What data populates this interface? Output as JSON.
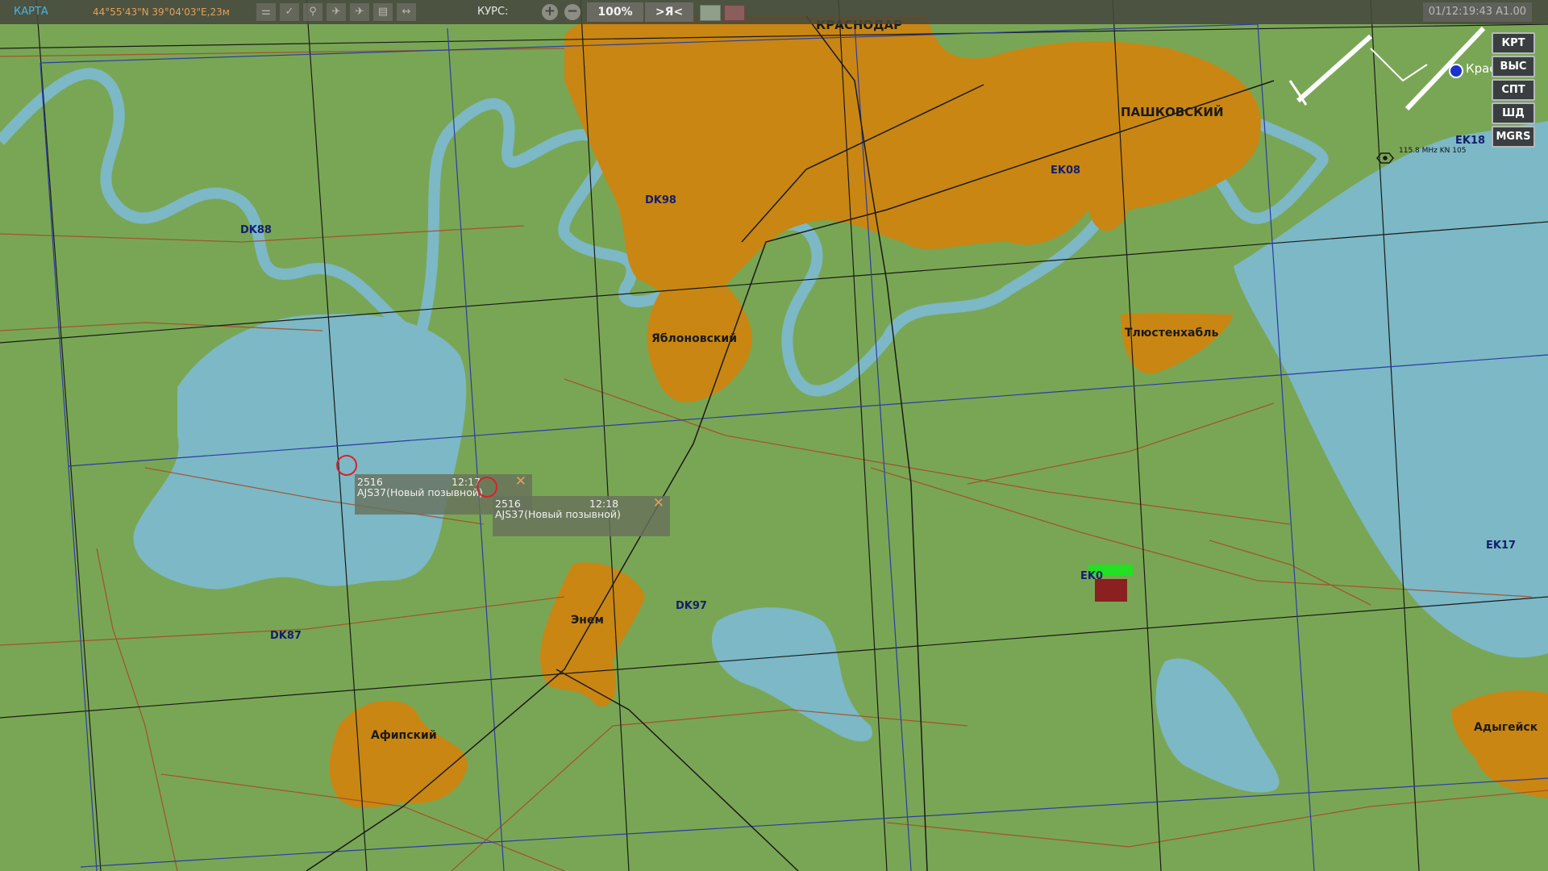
{
  "toolbar": {
    "mode": "КАРТА",
    "coords": "44°55'43\"N 39°04'03\"E,23м",
    "course_label": "КУРС:",
    "zoom_in": "+",
    "zoom_out": "−",
    "zoom_level": "100%",
    "center_self": ">Я<",
    "datetime": "01/12:19:43 A1.00"
  },
  "side_buttons": [
    "КРТ",
    "ВЫС",
    "СПТ",
    "ШД",
    "MGRS"
  ],
  "places": {
    "krasnodar": "КРАСНОДАР",
    "pashkovsky": "ПАШКОВСКИЙ",
    "yablonovsky": "Яблоновский",
    "tlyustenkhabl": "Тлюстенхабль",
    "enem": "Энем",
    "afipsky": "Афипский",
    "adygeysk": "Адыгейск",
    "airfield": "Крас"
  },
  "grid_labels": {
    "dk88": "DK88",
    "dk98": "DK98",
    "dk87": "DK87",
    "dk97": "DK97",
    "ek08": "EK08",
    "ek18": "EK18",
    "ek17": "EK17",
    "ek07": "EK0"
  },
  "beacon_info": "115.8 MHz KN 105",
  "waypoints": [
    {
      "number": "2516",
      "time": "12:17",
      "callsign": "AJS37(Новый позывной)"
    },
    {
      "number": "2516",
      "time": "12:18",
      "callsign": "AJS37(Новый позывной)"
    }
  ],
  "colors": {
    "land": "#79a654",
    "water": "#7cb8c6",
    "urban": "#c98612",
    "grid_black": "#1a1a1a",
    "grid_blue": "#2b3ca4",
    "roads": "#a64a26",
    "marker": "#d8222a"
  }
}
